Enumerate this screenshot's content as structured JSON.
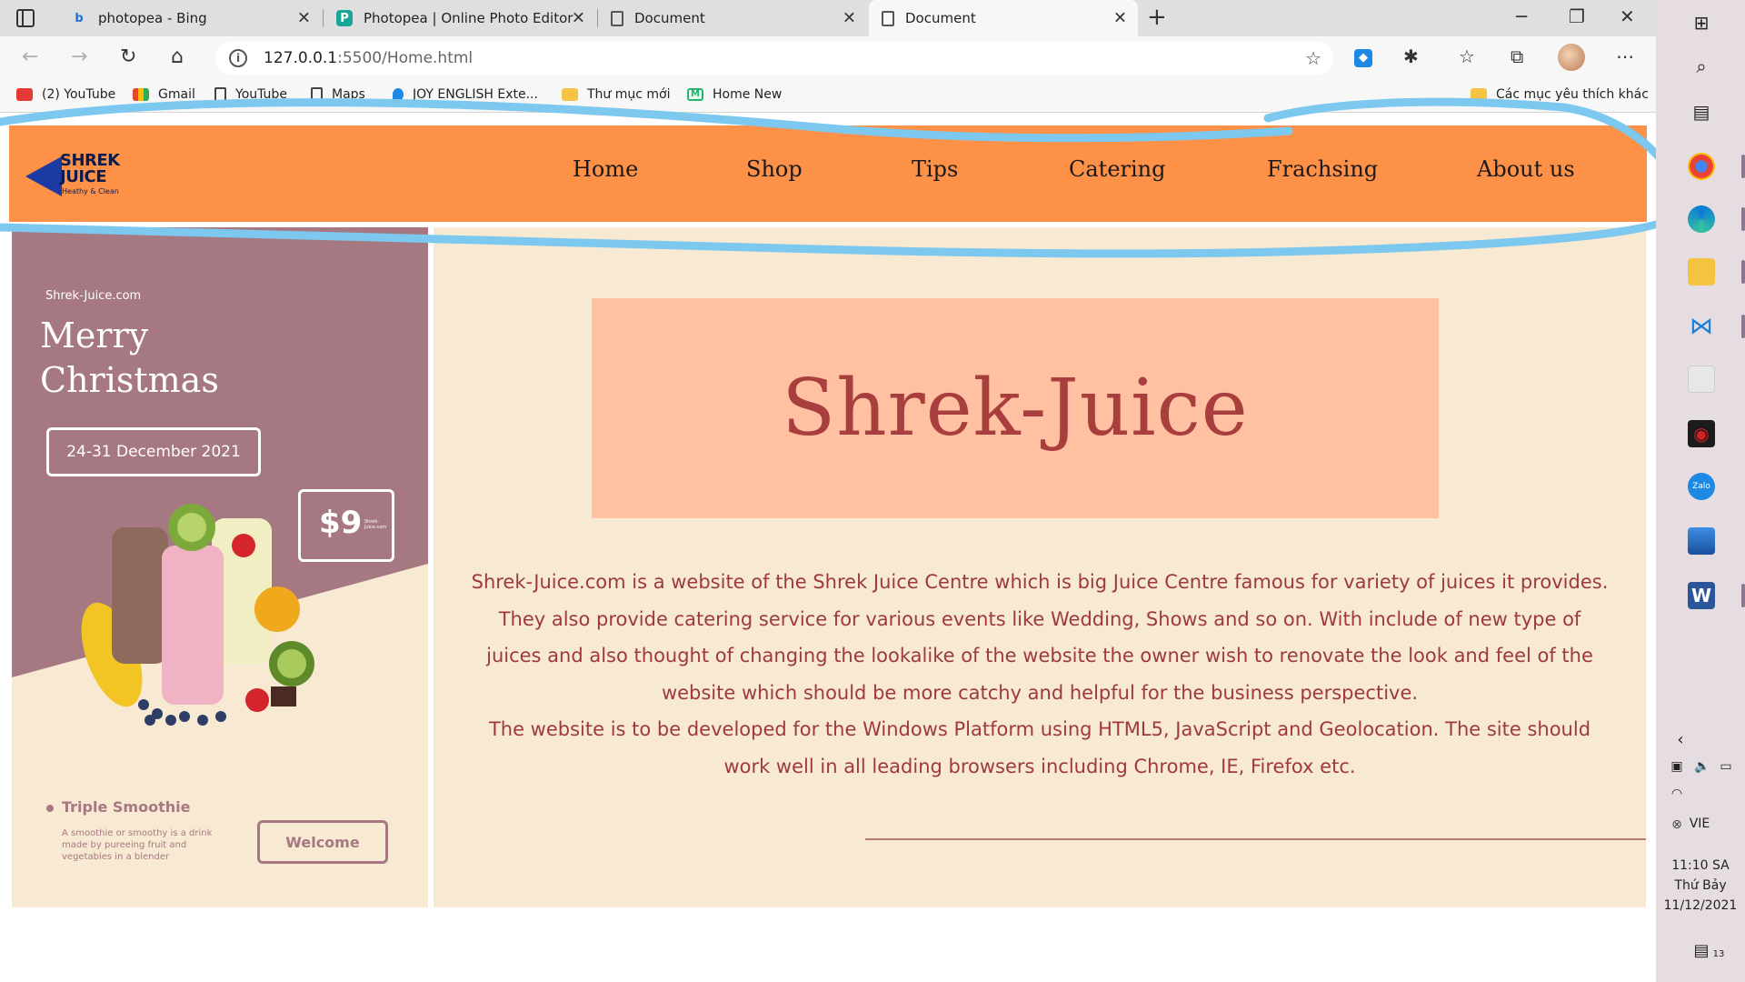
{
  "browser": {
    "tabs": [
      {
        "title": "photopea - Bing",
        "favicon": "bing-icon"
      },
      {
        "title": "Photopea | Online Photo Editor",
        "favicon": "photopea-icon"
      },
      {
        "title": "Document",
        "favicon": "document-icon"
      },
      {
        "title": "Document",
        "favicon": "document-icon",
        "active": true
      }
    ],
    "url_host": "127.0.0.1",
    "url_rest": ":5500/Home.html",
    "bookmarks": [
      {
        "label": "(2) YouTube",
        "icon": "youtube-icon"
      },
      {
        "label": "Gmail",
        "icon": "gmail-icon"
      },
      {
        "label": "YouTube",
        "icon": "page-icon"
      },
      {
        "label": "Maps",
        "icon": "page-icon"
      },
      {
        "label": "JOY ENGLISH Exte...",
        "icon": "drop-icon"
      },
      {
        "label": "Thư mục mới",
        "icon": "folder-icon"
      },
      {
        "label": "Home New",
        "icon": "m-icon"
      }
    ],
    "other_bookmarks": "Các mục yêu thích khác"
  },
  "site": {
    "logo": {
      "name_line1": "SHREK",
      "name_line2": "JUICE",
      "tagline": "Heathy & Clean"
    },
    "nav": [
      "Home",
      "Shop",
      "Tips",
      "Catering",
      "Frachsing",
      "About us"
    ],
    "promo": {
      "site": "Shrek-Juice.com",
      "title": "Merry Christmas",
      "date": "24-31 December 2021",
      "price": "$9",
      "price_note": "Shrek-Juice.com",
      "product": "Triple Smoothie",
      "product_desc": "A smoothie or smoothy is a drink made by pureeing fruit and vegetables in a blender",
      "button": "Welcome"
    },
    "brand_title": "Shrek-Juice",
    "description_p1": "Shrek-Juice.com is a website of the Shrek Juice Centre which is big Juice Centre famous for variety of juices it provides. They also provide catering service for various events like Wedding, Shows and so on. With include of new type of juices and also thought of changing the lookalike of the website the owner wish to renovate the look and feel of the website which should be more catchy and helpful for the business perspective.",
    "description_p2": "The website is to be developed for the Windows Platform using HTML5, JavaScript and Geolocation. The site should work well in all leading browsers including Chrome, IE, Firefox etc."
  },
  "taskbar": {
    "language": "VIE",
    "time": "11:10 SA",
    "day": "Thứ Bảy",
    "date": "11/12/2021",
    "notifications": "13"
  },
  "colors": {
    "nav_bg": "#fe9148",
    "content_bg": "#f8e9d3",
    "brand_box": "#ffc1a1",
    "brand_text": "#a83e3e",
    "promo_mauve": "#a67882",
    "annotation": "#7cc8ee"
  }
}
